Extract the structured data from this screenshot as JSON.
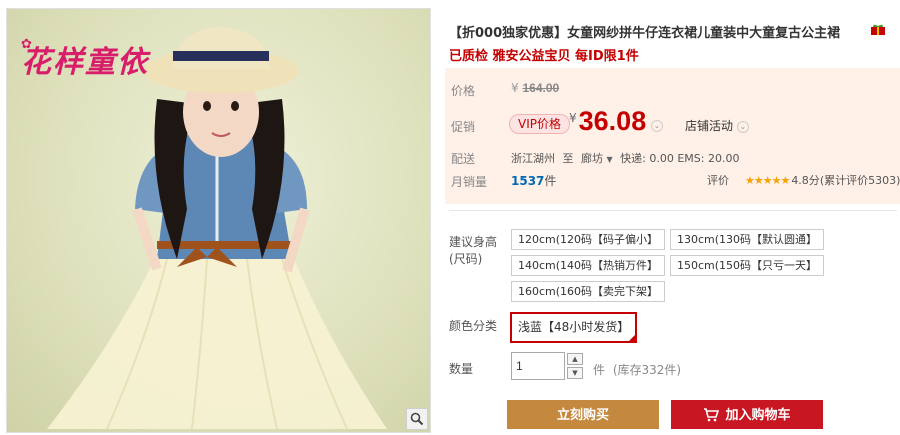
{
  "brand": {
    "logo_text": "花样童依"
  },
  "product": {
    "title": "【折000独家优惠】女童网纱拼牛仔连衣裙儿童装中大童复古公主裙",
    "subtitle": "已质检 雅安公益宝贝 每ID限1件"
  },
  "price": {
    "label": "价格",
    "currency": "¥",
    "original": "164.00"
  },
  "promo": {
    "label": "促销",
    "vip_tag": "VIP价格",
    "currency": "¥",
    "price": "36.08",
    "shop_activity": "店铺活动"
  },
  "shipping": {
    "label": "配送",
    "from": "浙江湖州",
    "to_word": "至",
    "to": "廊坊",
    "express": "快递: 0.00 EMS: 20.00"
  },
  "sales": {
    "label": "月销量",
    "count": "1537",
    "unit": "件"
  },
  "rating": {
    "label": "评价",
    "stars": "★★★★★",
    "score": "4.8分",
    "count_text": "(累计评价5303)"
  },
  "size": {
    "label": "建议身高(尺码)",
    "options": [
      "120cm(120码【码子偏小】",
      "130cm(130码【默认圆通】",
      "140cm(140码【热销万件】",
      "150cm(150码【只亏一天】",
      "160cm(160码【卖完下架】"
    ]
  },
  "color": {
    "label": "颜色分类",
    "selected": "浅蓝【48小时发货】"
  },
  "quantity": {
    "label": "数量",
    "value": "1",
    "unit": "件",
    "stock_text": "(库存332件)"
  },
  "buttons": {
    "buy_now": "立刻购买",
    "add_to_cart": "加入购物车"
  },
  "colors": {
    "accent_red": "#c40000",
    "buy_now_bg": "#c4893f",
    "add_cart_bg": "#c81623",
    "price_box_bg": "#fff0e8"
  }
}
